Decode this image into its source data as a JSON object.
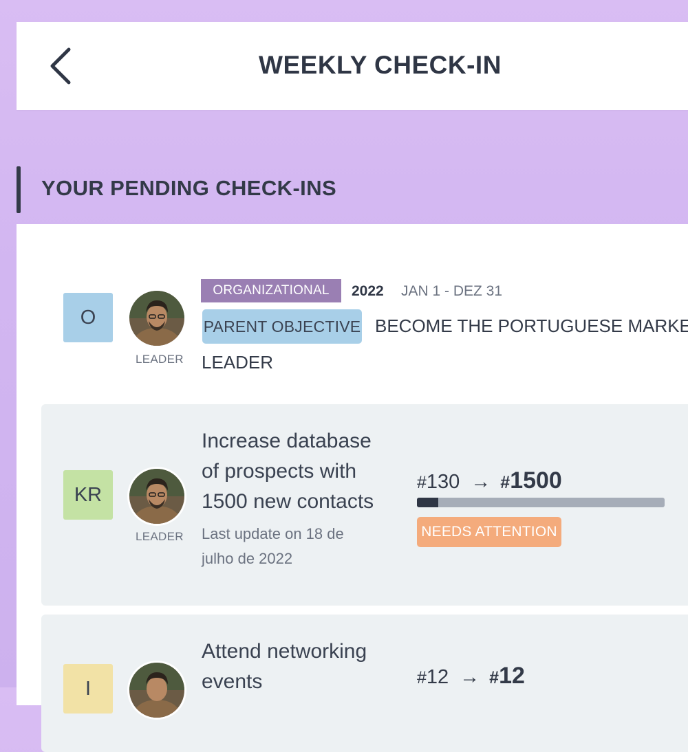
{
  "header": {
    "title": "WEEKLY CHECK-IN"
  },
  "section": {
    "title": "YOUR PENDING CHECK-INS"
  },
  "objective": {
    "tile": "O",
    "tile_color": "#a8cfe8",
    "leader_label": "LEADER",
    "type_badge": "ORGANIZATIONAL",
    "type_badge_color": "#9a7fb3",
    "year": "2022",
    "period": "JAN 1 - DEZ 31",
    "parent_badge": "PARENT OBJECTIVE",
    "parent_badge_color": "#a8cfe8",
    "title_line1": "BECOME THE PORTUGUESE MARKET",
    "title_line2": "LEADER"
  },
  "key_results": [
    {
      "tile": "KR",
      "tile_color": "#c4e2a4",
      "leader_label": "LEADER",
      "title_lines": [
        "Increase database",
        "of prospects with",
        "1500 new contacts"
      ],
      "last_update_lines": [
        "Last update on 18 de",
        "julho de 2022"
      ],
      "start_hash": "#",
      "start_value": "130",
      "arrow": "→",
      "target_hash": "#",
      "target_value": "1500",
      "progress": 0.087,
      "status": "NEEDS ATTENTION",
      "status_color": "#f4ab7c"
    },
    {
      "tile": "I",
      "tile_color": "#f2e2a6",
      "title_lines": [
        "Attend networking",
        "events"
      ],
      "start_hash": "#",
      "start_value": "12",
      "arrow": "→",
      "target_hash": "#",
      "target_value": "12"
    }
  ],
  "colors": {
    "accent_dark": "#2f3645",
    "background": "#d5b9f2"
  }
}
